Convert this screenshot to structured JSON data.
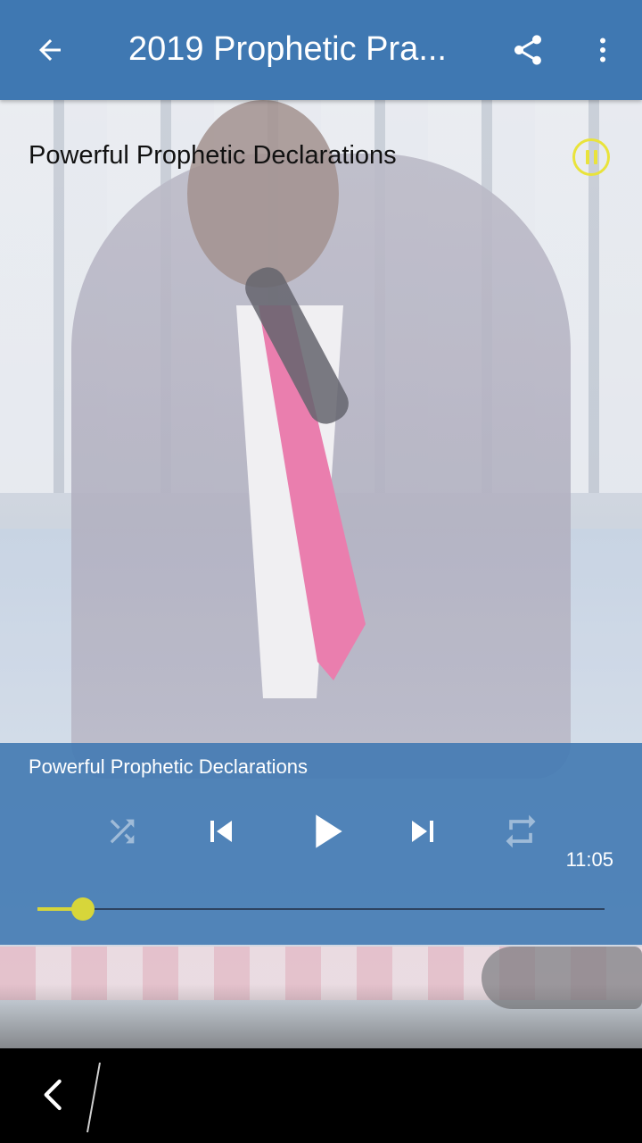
{
  "appbar": {
    "title": "2019 Prophetic Pra...",
    "back_icon": "arrow-left-icon",
    "share_icon": "share-icon",
    "more_icon": "more-vert-icon",
    "background": "#3f78b2"
  },
  "now_playing": {
    "title": "Powerful Prophetic Declarations",
    "status_icon": "pause-circle-icon",
    "accent": "#e9e33b"
  },
  "player": {
    "track_title": "Powerful Prophetic Declarations",
    "duration": "11:05",
    "progress": 0.08,
    "controls": {
      "shuffle": "shuffle-icon",
      "previous": "skip-previous-icon",
      "play": "play-icon",
      "next": "skip-next-icon",
      "repeat": "repeat-icon"
    },
    "seek_color": "#d7d63a"
  },
  "system_nav": {
    "back_icon": "nav-back-icon"
  }
}
